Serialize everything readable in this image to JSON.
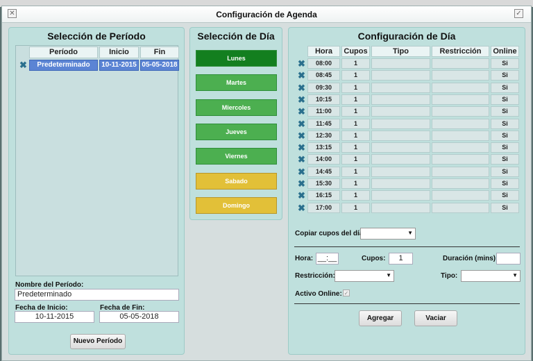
{
  "window": {
    "title": "Configuración de Agenda",
    "close_icon": "close-icon",
    "confirm_icon": "check-icon"
  },
  "periodo": {
    "title": "Selección de Período",
    "columns": [
      "Período",
      "Inicio",
      "Fin"
    ],
    "rows": [
      {
        "periodo": "Predeterminado",
        "inicio": "10-11-2015",
        "fin": "05-05-2018",
        "remove_icon": "remove-x-icon"
      }
    ],
    "nombre_label": "Nombre del Período:",
    "nombre_value": "Predeterminado",
    "inicio_label": "Fecha de Inicio:",
    "inicio_value": "10-11-2015",
    "fin_label": "Fecha de Fin:",
    "fin_value": "05-05-2018",
    "nuevo_button": "Nuevo Período"
  },
  "dias": {
    "title": "Selección de Día",
    "items": [
      {
        "label": "Lunes",
        "color": "#137f1f"
      },
      {
        "label": "Martes",
        "color": "#4caf50"
      },
      {
        "label": "Miercoles",
        "color": "#4caf50"
      },
      {
        "label": "Jueves",
        "color": "#4caf50"
      },
      {
        "label": "Viernes",
        "color": "#4caf50"
      },
      {
        "label": "Sabado",
        "color": "#e2c038"
      },
      {
        "label": "Domingo",
        "color": "#e2c038"
      }
    ]
  },
  "config": {
    "title": "Configuración de Día",
    "columns": [
      "Hora",
      "Cupos",
      "Tipo",
      "Restricción",
      "Online"
    ],
    "rows": [
      {
        "hora": "08:00",
        "cupos": "1",
        "online": "Si"
      },
      {
        "hora": "08:45",
        "cupos": "1",
        "online": "Si"
      },
      {
        "hora": "09:30",
        "cupos": "1",
        "online": "Si"
      },
      {
        "hora": "10:15",
        "cupos": "1",
        "online": "Si"
      },
      {
        "hora": "11:00",
        "cupos": "1",
        "online": "Si"
      },
      {
        "hora": "11:45",
        "cupos": "1",
        "online": "Si"
      },
      {
        "hora": "12:30",
        "cupos": "1",
        "online": "Si"
      },
      {
        "hora": "13:15",
        "cupos": "1",
        "online": "Si"
      },
      {
        "hora": "14:00",
        "cupos": "1",
        "online": "Si"
      },
      {
        "hora": "14:45",
        "cupos": "1",
        "online": "Si"
      },
      {
        "hora": "15:30",
        "cupos": "1",
        "online": "Si"
      },
      {
        "hora": "16:15",
        "cupos": "1",
        "online": "Si"
      },
      {
        "hora": "17:00",
        "cupos": "1",
        "online": "Si"
      }
    ],
    "copiar_label": "Copiar cupos del día:",
    "hora_label": "Hora:",
    "hora_value": "__:__",
    "cupos_label": "Cupos:",
    "cupos_value": "1",
    "duracion_label": "Duración (mins):",
    "restriccion_label": "Restricción:",
    "tipo_label": "Tipo:",
    "activo_label": "Activo Online:",
    "agregar_button": "Agregar",
    "vaciar_button": "Vaciar"
  }
}
